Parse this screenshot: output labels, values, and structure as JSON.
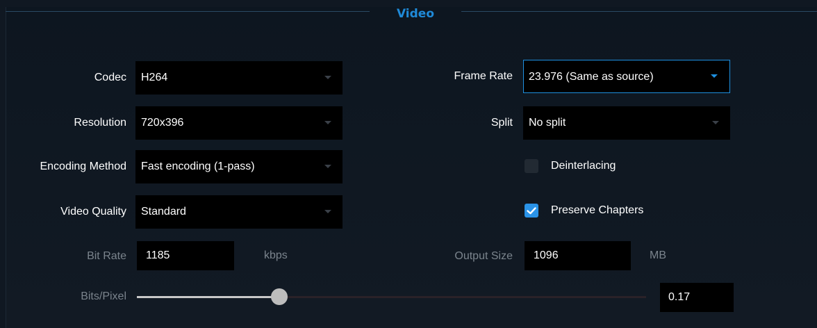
{
  "section": {
    "title": "Video"
  },
  "left": {
    "codec": {
      "label": "Codec",
      "value": "H264"
    },
    "resolution": {
      "label": "Resolution",
      "value": "720x396"
    },
    "encoding_method": {
      "label": "Encoding Method",
      "value": "Fast encoding (1-pass)"
    },
    "video_quality": {
      "label": "Video Quality",
      "value": "Standard"
    },
    "bit_rate": {
      "label": "Bit Rate",
      "value": "1185",
      "unit": "kbps"
    }
  },
  "right": {
    "frame_rate": {
      "label": "Frame Rate",
      "value": "23.976 (Same as source)"
    },
    "split": {
      "label": "Split",
      "value": "No split"
    },
    "deinterlacing": {
      "label": "Deinterlacing",
      "checked": false
    },
    "preserve_chapters": {
      "label": "Preserve Chapters",
      "checked": true
    },
    "output_size": {
      "label": "Output Size",
      "value": "1096",
      "unit": "MB"
    }
  },
  "bits_per_pixel": {
    "label": "Bits/Pixel",
    "value": "0.17",
    "slider_fraction": 0.28
  },
  "colors": {
    "accent": "#1e90e0",
    "background": "#101822",
    "field": "#000000",
    "dim_text": "#7b848d"
  },
  "icons": {
    "dropdown": "chevron-down-icon",
    "check": "checkmark-icon"
  }
}
